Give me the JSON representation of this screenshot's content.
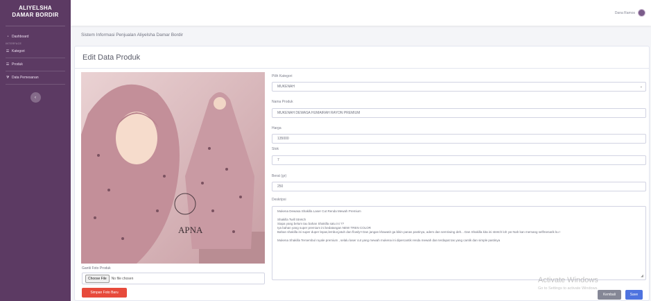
{
  "sidebar": {
    "brand_line1": "ALIYELSHA",
    "brand_line2": "DAMAR BORDIR",
    "dashboard_label": "Dashboard",
    "heading": "INTERFACE",
    "items": [
      {
        "label": "Kategori",
        "icon": "list-icon"
      },
      {
        "label": "Produk",
        "icon": "list-icon"
      },
      {
        "label": "Data Pemesanan",
        "icon": "filter-icon"
      }
    ],
    "toggle_icon": "chevron-left-icon",
    "toggle_glyph": "‹"
  },
  "topbar": {
    "user_name": "Dana Ramos",
    "avatar_icon": "user-avatar"
  },
  "system_title": "Sistem Informasi Penjualan Aliyelsha Damar Bordir",
  "card": {
    "title": "Edit Data Produk"
  },
  "photo": {
    "logo_text": "APNA"
  },
  "image_form": {
    "label": "Gantii Foto Produk",
    "file_button": "Choose File",
    "file_status": "No file chosen",
    "save_photo_button": "Simpan Foto Baru"
  },
  "form": {
    "kategori_label": "Pilih Kategori",
    "kategori_value": "MUKENAH",
    "nama_label": "Nama Produk",
    "nama_value": "MUKENAH DEWASA HUMAIRAH RAYON PREMIUM",
    "harga_label": "Harga",
    "harga_value": "135000",
    "stok_label": "Stok",
    "stok_value": "7",
    "berat_label": "Berat (gr)",
    "berat_value": "250",
    "deskripsi_label": "Deskripsi",
    "deskripsi_lines": [
      "Mukena Dewasa Shakilla Laser Cut Renda Mewah Premium",
      "",
      "Shakilla Twill Stretch",
      "Siapa yang belum tau bahan Shakilla satu ini ??",
      "Iya bahan yang super premium ini kedatangan NEW TREN COLOR",
      "Bahan shakilla ini super duper lepas,lembut,jatuh dan flowly!! Dan jangan khawatir ga bikin panas pastinya, adem dan semriwing deh... Dan Shakilla kita ini stretch loh ya! Nah kan memang selfmenarik ku !",
      "",
      "Mukena Shakilla Tersembul royale premium , selalu laser cut yang mewah mukena ini dipercantik renda mewah dan terdapat tas yang cantik dan simple pastinya"
    ]
  },
  "watermark": {
    "title": "Activate Windows",
    "subtitle": "Go to Settings to activate Windows."
  },
  "buttons": {
    "back": "Kembali",
    "save": "Save"
  }
}
